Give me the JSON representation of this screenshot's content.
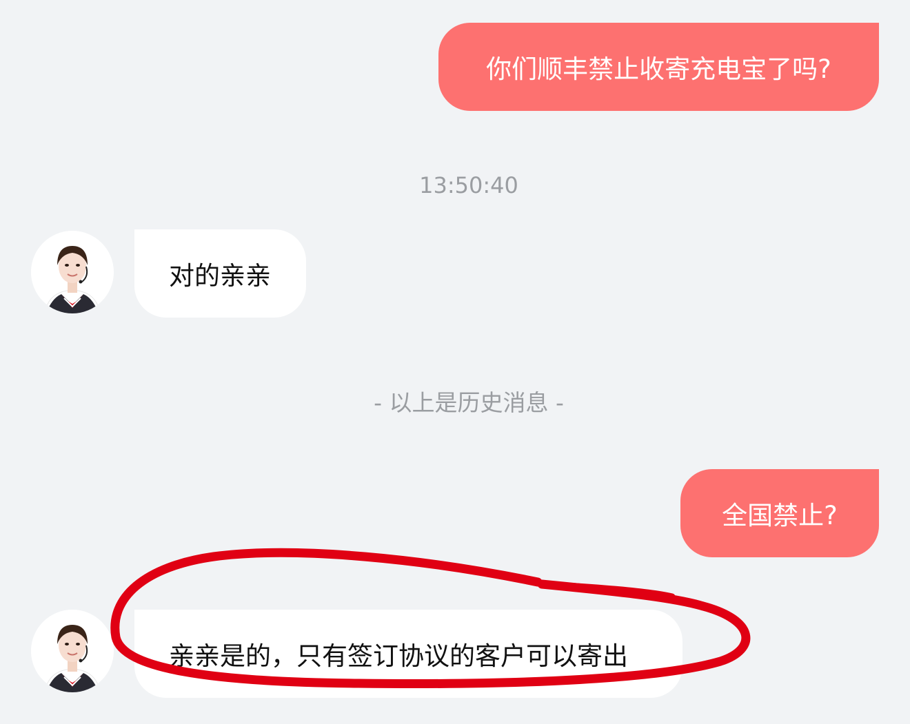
{
  "messages": [
    {
      "role": "user",
      "text": "你们顺丰禁止收寄充电宝了吗?"
    },
    {
      "role": "agent",
      "text": "对的亲亲"
    },
    {
      "role": "user",
      "text": "全国禁止?"
    },
    {
      "role": "agent",
      "text": "亲亲是的，只有签订协议的客户可以寄出"
    }
  ],
  "timestamp": "13:50:40",
  "history_divider": "- 以上是历史消息 -",
  "colors": {
    "user_bubble": "#fd7170",
    "agent_bubble": "#ffffff",
    "background": "#f1f3f5",
    "annotation_circle": "#e00013"
  },
  "icons": {
    "agent_avatar": "customer-service-agent-avatar"
  }
}
